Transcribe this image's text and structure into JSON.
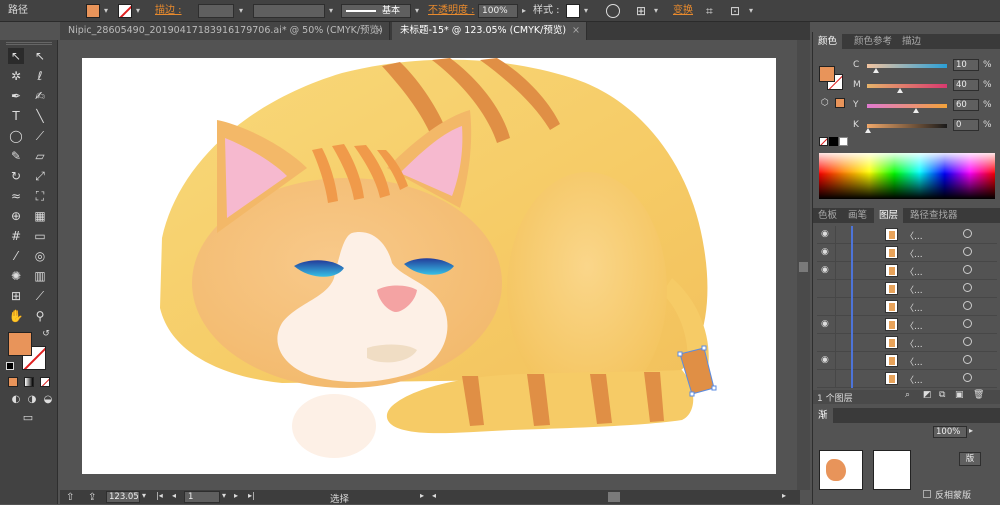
{
  "control_bar": {
    "selection_label": "路径",
    "fill_color": "#e8945a",
    "stroke_label": "描边 :",
    "stroke_profile": "基本",
    "opacity_label": "不透明度 :",
    "opacity_value": "100%",
    "style_label": "样式 :",
    "transform_label": "变换"
  },
  "tabs": [
    {
      "label": "Nipic_28605490_20190417183916179706.ai* @ 50% (CMYK/预览)",
      "close": "×"
    },
    {
      "label": "未标题-15* @ 123.05% (CMYK/预览)",
      "close": "×"
    }
  ],
  "color_panel": {
    "tabs": [
      "颜色",
      "颜色参考",
      "描边"
    ],
    "sliders": [
      {
        "label": "C",
        "value": "10",
        "unit": "%",
        "fraction": 0.1,
        "gradient": "linear-gradient(90deg,#f2c4a0,#2a9fd6)"
      },
      {
        "label": "M",
        "value": "40",
        "unit": "%",
        "fraction": 0.4,
        "gradient": "linear-gradient(90deg,#e6b36a,#d8396f)"
      },
      {
        "label": "Y",
        "value": "60",
        "unit": "%",
        "fraction": 0.6,
        "gradient": "linear-gradient(90deg,#e07ad1,#f2a23a)"
      },
      {
        "label": "K",
        "value": "0",
        "unit": "%",
        "fraction": 0.0,
        "gradient": "linear-gradient(90deg,#f0a86a,#1a1a1a)"
      }
    ]
  },
  "layers_panel": {
    "tabs": [
      "色板",
      "画笔",
      "图层",
      "路径查找器"
    ],
    "row_label": "〈...",
    "footer": "1 个图层",
    "bottom_label": "反相蒙版"
  },
  "gradient_panel": {
    "label": "渐",
    "opacity_value": "100%",
    "button_label": "版"
  },
  "status_bar": {
    "zoom": "123.05",
    "page": "1",
    "tool": "选择"
  },
  "colors": {
    "accent_fill": "#e8945a",
    "cat_body": "#f6cc6b",
    "stripe": "#e08a3c",
    "ear_inner": "#f4b8cc",
    "eye": "#2d4fb0",
    "nose": "#f2a3a0"
  }
}
